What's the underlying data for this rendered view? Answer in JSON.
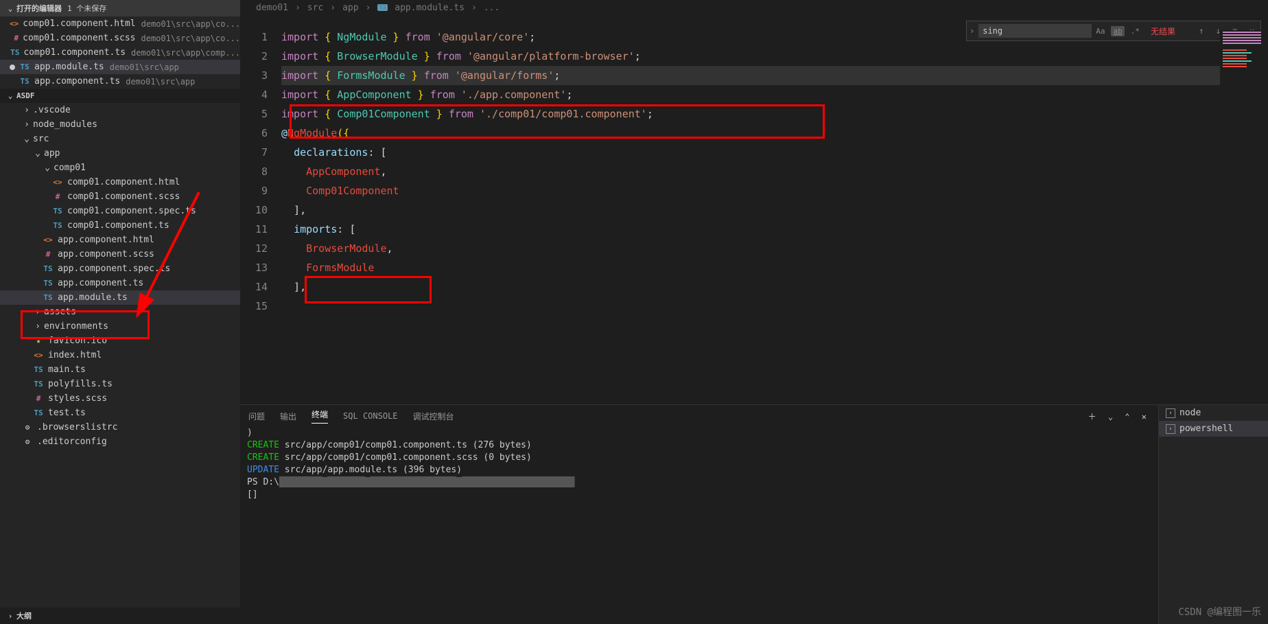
{
  "openEditors": {
    "title": "打开的编辑器",
    "unsaved": "1 个未保存",
    "items": [
      {
        "icon": "html",
        "name": "comp01.component.html",
        "path": "demo01\\src\\app\\co...",
        "mod": false
      },
      {
        "icon": "scss",
        "name": "comp01.component.scss",
        "path": "demo01\\src\\app\\co...",
        "mod": false
      },
      {
        "icon": "ts",
        "name": "comp01.component.ts",
        "path": "demo01\\src\\app\\comp...",
        "mod": false
      },
      {
        "icon": "ts",
        "name": "app.module.ts",
        "path": "demo01\\src\\app",
        "mod": true,
        "active": true
      },
      {
        "icon": "ts",
        "name": "app.component.ts",
        "path": "demo01\\src\\app",
        "mod": false
      }
    ]
  },
  "explorer": {
    "root": "ASDF",
    "tree": [
      {
        "t": "folder",
        "n": ".vscode",
        "cls": "indent-1",
        "c": "›"
      },
      {
        "t": "folder",
        "n": "node_modules",
        "cls": "indent-1",
        "c": "›"
      },
      {
        "t": "folder",
        "n": "src",
        "cls": "indent-1",
        "c": "⌄",
        "open": true
      },
      {
        "t": "folder",
        "n": "app",
        "cls": "indent-2",
        "c": "⌄",
        "open": true
      },
      {
        "t": "folder",
        "n": "comp01",
        "cls": "indent-3",
        "c": "⌄",
        "open": true
      },
      {
        "t": "file",
        "n": "comp01.component.html",
        "ic": "html",
        "cls": "indent-4"
      },
      {
        "t": "file",
        "n": "comp01.component.scss",
        "ic": "scss",
        "cls": "indent-4"
      },
      {
        "t": "file",
        "n": "comp01.component.spec.ts",
        "ic": "ts",
        "cls": "indent-4"
      },
      {
        "t": "file",
        "n": "comp01.component.ts",
        "ic": "ts",
        "cls": "indent-4"
      },
      {
        "t": "file",
        "n": "app.component.html",
        "ic": "html",
        "cls": "indent-3"
      },
      {
        "t": "file",
        "n": "app.component.scss",
        "ic": "scss",
        "cls": "indent-3"
      },
      {
        "t": "file",
        "n": "app.component.spec.ts",
        "ic": "ts",
        "cls": "indent-3"
      },
      {
        "t": "file",
        "n": "app.component.ts",
        "ic": "ts",
        "cls": "indent-3"
      },
      {
        "t": "file",
        "n": "app.module.ts",
        "ic": "ts",
        "cls": "indent-3",
        "active": true
      },
      {
        "t": "folder",
        "n": "assets",
        "cls": "indent-2",
        "c": "›"
      },
      {
        "t": "folder",
        "n": "environments",
        "cls": "indent-2",
        "c": "›"
      },
      {
        "t": "file",
        "n": "favicon.ico",
        "ic": "star",
        "cls": "indent-2"
      },
      {
        "t": "file",
        "n": "index.html",
        "ic": "html",
        "cls": "indent-2"
      },
      {
        "t": "file",
        "n": "main.ts",
        "ic": "ts",
        "cls": "indent-2"
      },
      {
        "t": "file",
        "n": "polyfills.ts",
        "ic": "ts",
        "cls": "indent-2"
      },
      {
        "t": "file",
        "n": "styles.scss",
        "ic": "scss",
        "cls": "indent-2"
      },
      {
        "t": "file",
        "n": "test.ts",
        "ic": "ts",
        "cls": "indent-2"
      },
      {
        "t": "file",
        "n": ".browserslistrc",
        "ic": "gear",
        "cls": "indent-1"
      },
      {
        "t": "file",
        "n": ".editorconfig",
        "ic": "gear",
        "cls": "indent-1"
      }
    ],
    "outline": "大纲"
  },
  "breadcrumb": [
    "demo01",
    "src",
    "app",
    "app.module.ts",
    "..."
  ],
  "breadcrumb_ts_icon": "TS",
  "code": {
    "lines": [
      1,
      2,
      3,
      4,
      5,
      6,
      7,
      8,
      9,
      10,
      11,
      12,
      13,
      14,
      15
    ],
    "l1": {
      "imp": "import",
      "b1": "{ ",
      "t": "NgModule",
      "b2": " }",
      "from": "from",
      "s": "'@angular/core'",
      "e": ";"
    },
    "l2": {
      "imp": "import",
      "b1": "{ ",
      "t": "BrowserModule",
      "b2": " }",
      "from": "from",
      "s": "'@angular/platform-browser'",
      "e": ";"
    },
    "l3": {
      "imp": "import",
      "b1": "{ ",
      "t": "FormsModule",
      "b2": " }",
      "from": "from",
      "s": "'@angular/forms'",
      "e": ";"
    },
    "l4": {
      "imp": "import",
      "b1": "{ ",
      "t": "AppComponent",
      "b2": " }",
      "from": "from",
      "s": "'./app.component'",
      "e": ";"
    },
    "l5": {
      "imp": "import",
      "b1": "{ ",
      "t": "Comp01Component",
      "b2": " }",
      "from": "from",
      "s": "'./comp01/comp01.component'",
      "e": ";"
    },
    "l7": {
      "at": "@",
      "ng": "NgModule",
      "p": "({"
    },
    "l8": {
      "k": "declarations",
      "p": ": ["
    },
    "l9": {
      "v": "AppComponent",
      "c": ","
    },
    "l10": {
      "v": "Comp01Component"
    },
    "l11": {
      "p": "],"
    },
    "l12": {
      "k": "imports",
      "p": ": ["
    },
    "l13": {
      "v": "BrowserModule",
      "c": ","
    },
    "l14": {
      "v": "FormsModule"
    },
    "l15": {
      "p": "],"
    }
  },
  "find": {
    "value": "sing",
    "result": "无结果",
    "aa": "Aa",
    "ab": "ab",
    "re": ".*"
  },
  "panel": {
    "tabs": [
      "问题",
      "输出",
      "终端",
      "SQL CONSOLE",
      "调试控制台"
    ],
    "activeIdx": 2,
    "lines": [
      {
        "pre": ")",
        "cls": ""
      },
      {
        "pre": "CREATE",
        "txt": " src/app/comp01/comp01.component.ts (276 bytes)",
        "cls": "grn"
      },
      {
        "pre": "CREATE",
        "txt": " src/app/comp01/comp01.component.scss (0 bytes)",
        "cls": "grn"
      },
      {
        "pre": "UPDATE",
        "txt": " src/app/app.module.ts (396 bytes)",
        "cls": "blu"
      },
      {
        "pre": "PS ",
        "txt": "D:\\",
        "after": "",
        "cls": "ps"
      },
      {
        "pre": "[]",
        "cls": ""
      }
    ],
    "side": [
      "node",
      "powershell"
    ],
    "sideSel": 1
  },
  "watermark": "CSDN @编程图一乐"
}
